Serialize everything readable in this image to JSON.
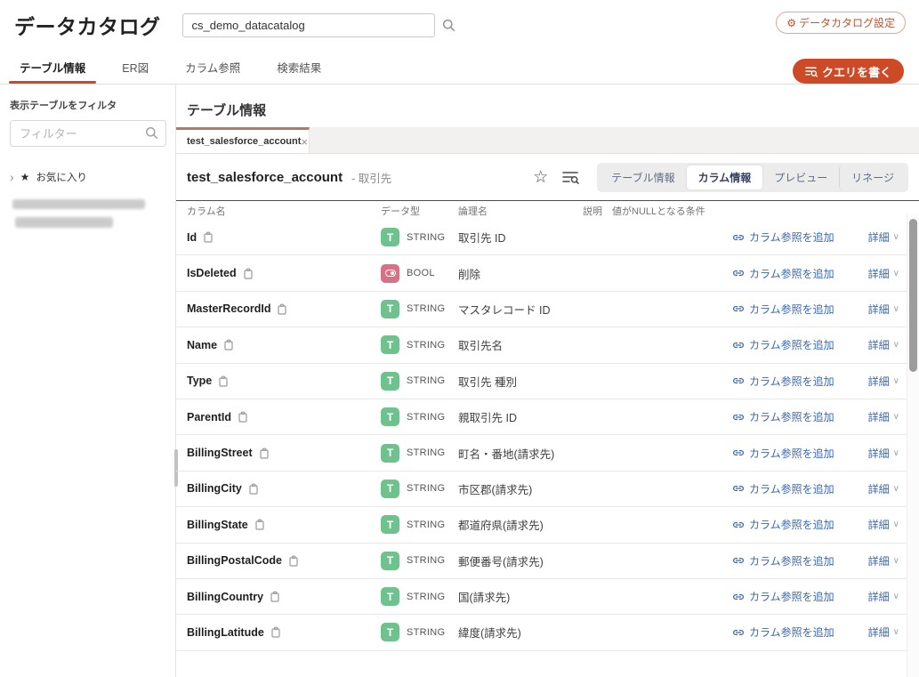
{
  "header": {
    "app_title": "データカタログ",
    "search_value": "cs_demo_datacatalog",
    "settings_button_label": "データカタログ設定"
  },
  "primary_tabs": {
    "items": [
      {
        "label": "テーブル情報"
      },
      {
        "label": "ER図"
      },
      {
        "label": "カラム参照"
      },
      {
        "label": "検索結果"
      }
    ],
    "active": "テーブル情報",
    "write_query_label": "クエリを書く"
  },
  "sidebar": {
    "filter_label": "表示テーブルをフィルタ",
    "filter_placeholder": "フィルター",
    "favorites_label": "お気に入り"
  },
  "main": {
    "section_title": "テーブル情報",
    "doc_tab_label": "test_salesforce_account",
    "table_title": "test_salesforce_account",
    "table_subtitle": "- 取引先",
    "view_tabs": [
      "テーブル情報",
      "カラム情報",
      "プレビュー",
      "リネージ"
    ],
    "view_tab_active": "カラム情報",
    "column_headers": [
      "カラム名",
      "データ型",
      "論理名",
      "説明",
      "値がNULLとなる条件"
    ],
    "add_reference_label": "カラム参照を追加",
    "details_label": "詳細",
    "rows": [
      {
        "name": "Id",
        "type": "STRING",
        "logical": "取引先 ID"
      },
      {
        "name": "IsDeleted",
        "type": "BOOL",
        "logical": "削除"
      },
      {
        "name": "MasterRecordId",
        "type": "STRING",
        "logical": "マスタレコード ID"
      },
      {
        "name": "Name",
        "type": "STRING",
        "logical": "取引先名"
      },
      {
        "name": "Type",
        "type": "STRING",
        "logical": "取引先 種別"
      },
      {
        "name": "ParentId",
        "type": "STRING",
        "logical": "親取引先 ID"
      },
      {
        "name": "BillingStreet",
        "type": "STRING",
        "logical": "町名・番地(請求先)"
      },
      {
        "name": "BillingCity",
        "type": "STRING",
        "logical": "市区郡(請求先)"
      },
      {
        "name": "BillingState",
        "type": "STRING",
        "logical": "都道府県(請求先)"
      },
      {
        "name": "BillingPostalCode",
        "type": "STRING",
        "logical": "郵便番号(請求先)"
      },
      {
        "name": "BillingCountry",
        "type": "STRING",
        "logical": "国(請求先)"
      },
      {
        "name": "BillingLatitude",
        "type": "STRING",
        "logical": "緯度(請求先)"
      }
    ]
  },
  "colors": {
    "accent": "#cd4a27",
    "doc_tab_top": "#b27b5f",
    "string_badge": "#6fc28e",
    "bool_badge": "#d97083",
    "link_blue": "#3a68b0"
  }
}
